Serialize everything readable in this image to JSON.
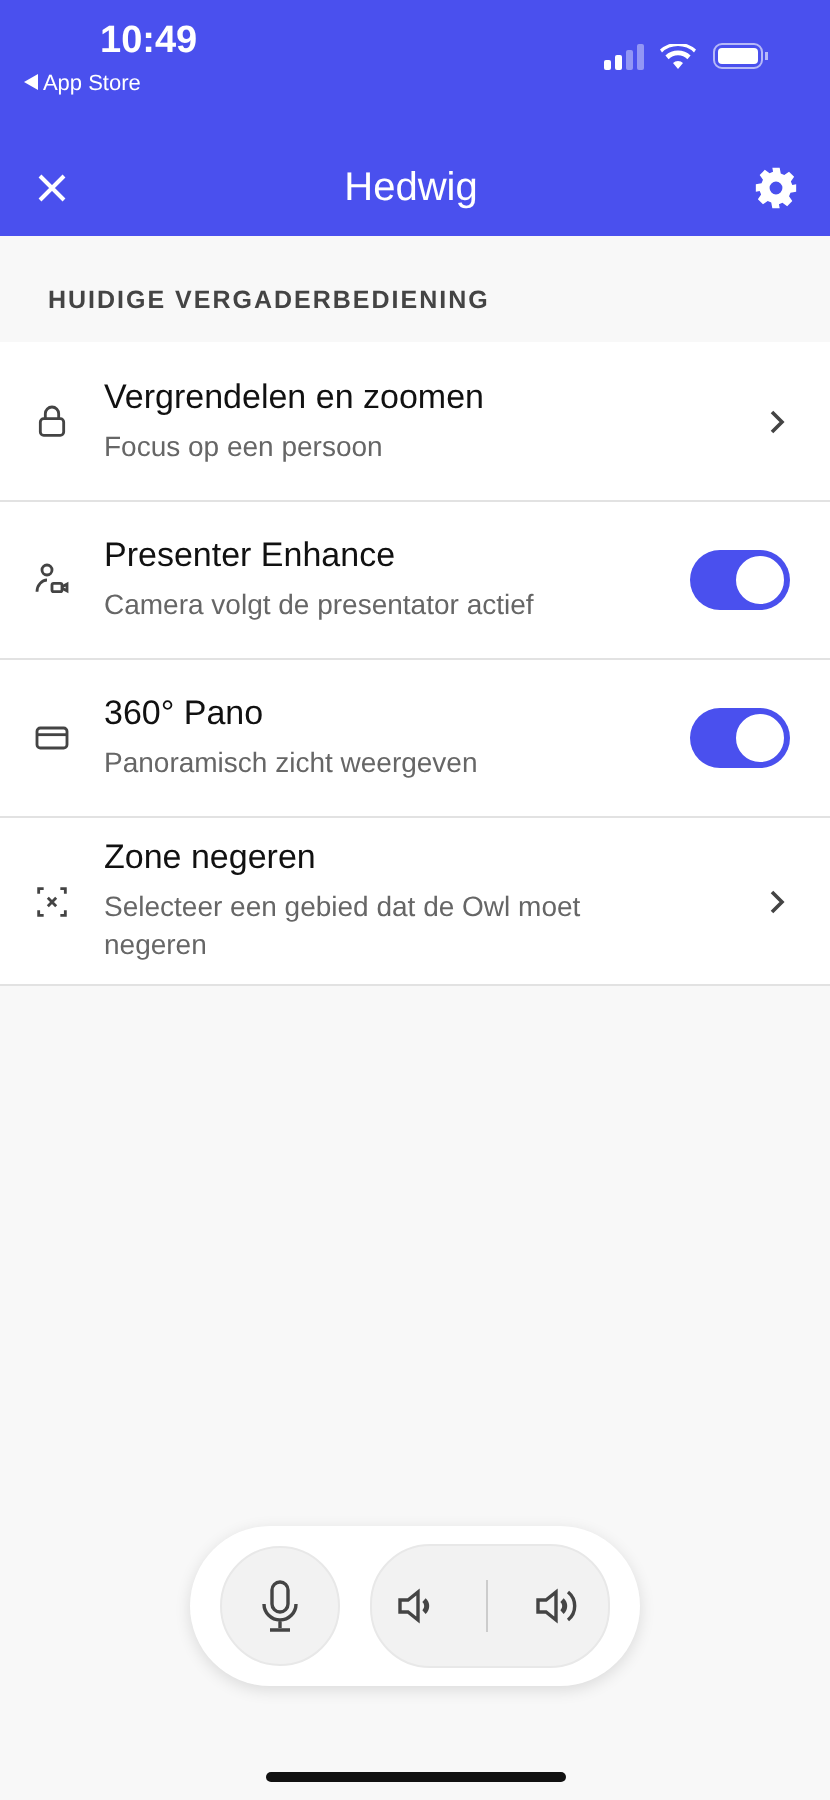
{
  "status_bar": {
    "time": "10:49",
    "back_label": "App Store"
  },
  "nav": {
    "title": "Hedwig"
  },
  "section": {
    "heading": "HUIDIGE VERGADERBEDIENING"
  },
  "items": [
    {
      "kind": "chevron",
      "title": "Vergrendelen en zoomen",
      "subtitle": "Focus op een persoon"
    },
    {
      "kind": "toggle",
      "title": "Presenter Enhance",
      "subtitle": "Camera volgt de presentator actief",
      "on": true
    },
    {
      "kind": "toggle",
      "title": "360° Pano",
      "subtitle": "Panoramisch zicht weergeven",
      "on": true
    },
    {
      "kind": "chevron",
      "title": "Zone negeren",
      "subtitle": "Selecteer een gebied dat de Owl moet negeren"
    }
  ]
}
